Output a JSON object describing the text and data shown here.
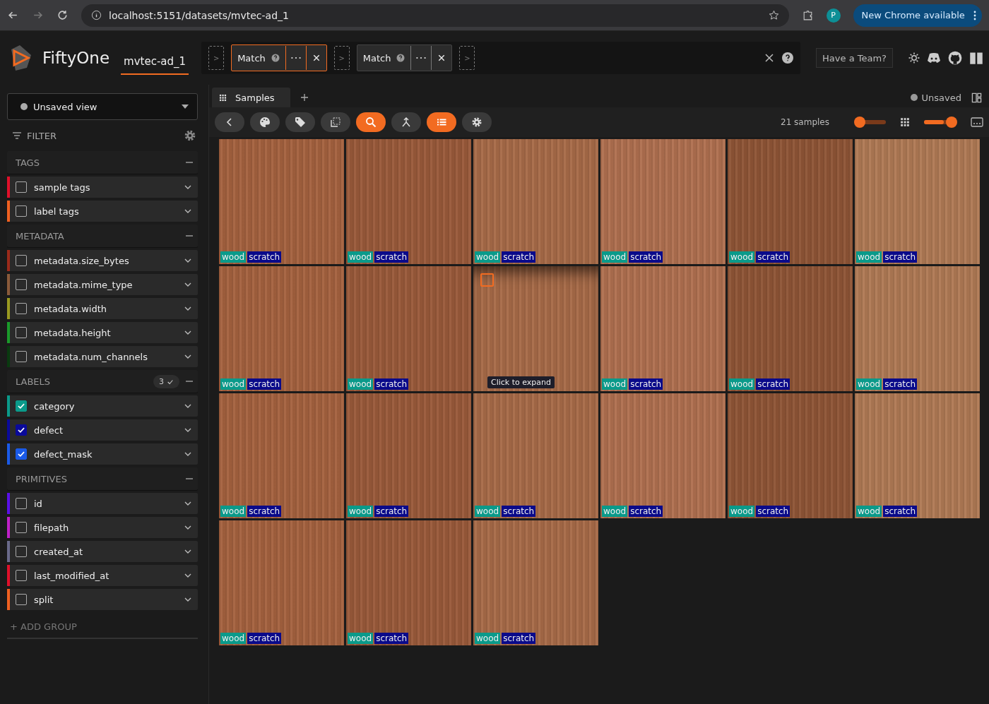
{
  "browser": {
    "url": "localhost:5151/datasets/mvtec-ad_1",
    "profile": "P",
    "update_button": "New Chrome available"
  },
  "header": {
    "app_name": "FiftyOne",
    "dataset": "mvtec-ad_1",
    "stages": [
      {
        "kind": "add",
        "label": ">"
      },
      {
        "kind": "stage",
        "label": "Match",
        "selected": true
      },
      {
        "kind": "add",
        "label": ">"
      },
      {
        "kind": "stage",
        "label": "Match",
        "selected": false
      },
      {
        "kind": "add",
        "label": ">"
      }
    ],
    "team_button": "Have a Team?"
  },
  "sidebar": {
    "view_selector": "Unsaved view",
    "filter_label": "FILTER",
    "groups": [
      {
        "title": "TAGS",
        "items": [
          {
            "label": "sample tags",
            "color": "#e0102a",
            "checked": false
          },
          {
            "label": "label tags",
            "color": "#f06020",
            "checked": false
          }
        ]
      },
      {
        "title": "METADATA",
        "items": [
          {
            "label": "metadata.size_bytes",
            "color": "#9b2a1a",
            "checked": false
          },
          {
            "label": "metadata.mime_type",
            "color": "#8a5a3a",
            "checked": false
          },
          {
            "label": "metadata.width",
            "color": "#9a9a20",
            "checked": false
          },
          {
            "label": "metadata.height",
            "color": "#1a9a2a",
            "checked": false
          },
          {
            "label": "metadata.num_channels",
            "color": "#0a3a10",
            "checked": false
          }
        ]
      },
      {
        "title": "LABELS",
        "badge": "3",
        "items": [
          {
            "label": "category",
            "color": "#0a9a8a",
            "checked": true
          },
          {
            "label": "defect",
            "color": "#0a0a9a",
            "checked": true
          },
          {
            "label": "defect_mask",
            "color": "#1a5ae8",
            "checked": true
          }
        ]
      },
      {
        "title": "PRIMITIVES",
        "items": [
          {
            "label": "id",
            "color": "#5a10e8",
            "checked": false
          },
          {
            "label": "filepath",
            "color": "#c020c8",
            "checked": false
          },
          {
            "label": "created_at",
            "color": "#6a6a8a",
            "checked": false
          },
          {
            "label": "last_modified_at",
            "color": "#e0102a",
            "checked": false
          },
          {
            "label": "split",
            "color": "#f06020",
            "checked": false
          }
        ]
      }
    ],
    "add_group": "+ ADD GROUP"
  },
  "tabs": [
    {
      "label": "Samples",
      "selected": true
    }
  ],
  "view_status": "Unsaved",
  "toolbar": {
    "buttons": [
      {
        "kind": "back",
        "active": false
      },
      {
        "kind": "palette",
        "active": false
      },
      {
        "kind": "tag",
        "active": false
      },
      {
        "kind": "select",
        "active": false
      },
      {
        "kind": "search",
        "active": true
      },
      {
        "kind": "merge",
        "active": false
      },
      {
        "kind": "list",
        "active": true
      },
      {
        "kind": "settings",
        "active": false
      }
    ],
    "count": "21 samples",
    "zoom_slider": {
      "level": 0.05
    },
    "size_slider": {
      "level": 0.7
    }
  },
  "samples": [
    {
      "tags": [
        {
          "label": "wood",
          "color": "#0a9a8a"
        },
        {
          "label": "scratch",
          "color": "#0a0a8a"
        }
      ]
    },
    {
      "tags": [
        {
          "label": "wood",
          "color": "#0a9a8a"
        },
        {
          "label": "scratch",
          "color": "#0a0a8a"
        }
      ]
    },
    {
      "tags": [
        {
          "label": "wood",
          "color": "#0a9a8a"
        },
        {
          "label": "scratch",
          "color": "#0a0a8a"
        }
      ]
    },
    {
      "tags": [
        {
          "label": "wood",
          "color": "#0a9a8a"
        },
        {
          "label": "scratch",
          "color": "#0a0a8a"
        }
      ]
    },
    {
      "tags": [
        {
          "label": "wood",
          "color": "#0a9a8a"
        },
        {
          "label": "scratch",
          "color": "#0a0a8a"
        }
      ]
    },
    {
      "tags": [
        {
          "label": "wood",
          "color": "#0a9a8a"
        },
        {
          "label": "scratch",
          "color": "#0a0a8a"
        }
      ]
    },
    {
      "tags": [
        {
          "label": "wood",
          "color": "#0a9a8a"
        },
        {
          "label": "scratch",
          "color": "#0a0a8a"
        }
      ]
    },
    {
      "tags": [
        {
          "label": "wood",
          "color": "#0a9a8a"
        },
        {
          "label": "scratch",
          "color": "#0a0a8a"
        }
      ]
    },
    {
      "hovered": true,
      "tooltip": "Click to expand"
    },
    {
      "tags": [
        {
          "label": "wood",
          "color": "#0a9a8a"
        },
        {
          "label": "scratch",
          "color": "#0a0a8a"
        }
      ]
    },
    {
      "tags": [
        {
          "label": "wood",
          "color": "#0a9a8a"
        },
        {
          "label": "scratch",
          "color": "#0a0a8a"
        }
      ]
    },
    {
      "tags": [
        {
          "label": "wood",
          "color": "#0a9a8a"
        },
        {
          "label": "scratch",
          "color": "#0a0a8a"
        }
      ]
    },
    {
      "tags": [
        {
          "label": "wood",
          "color": "#0a9a8a"
        },
        {
          "label": "scratch",
          "color": "#0a0a8a"
        }
      ]
    },
    {
      "tags": [
        {
          "label": "wood",
          "color": "#0a9a8a"
        },
        {
          "label": "scratch",
          "color": "#0a0a8a"
        }
      ]
    },
    {
      "tags": [
        {
          "label": "wood",
          "color": "#0a9a8a"
        },
        {
          "label": "scratch",
          "color": "#0a0a8a"
        }
      ]
    },
    {
      "tags": [
        {
          "label": "wood",
          "color": "#0a9a8a"
        },
        {
          "label": "scratch",
          "color": "#0a0a8a"
        }
      ]
    },
    {
      "tags": [
        {
          "label": "wood",
          "color": "#0a9a8a"
        },
        {
          "label": "scratch",
          "color": "#0a0a8a"
        }
      ]
    },
    {
      "tags": [
        {
          "label": "wood",
          "color": "#0a9a8a"
        },
        {
          "label": "scratch",
          "color": "#0a0a8a"
        }
      ]
    },
    {
      "tags": [
        {
          "label": "wood",
          "color": "#0a9a8a"
        },
        {
          "label": "scratch",
          "color": "#0a0a8a"
        }
      ]
    },
    {
      "tags": [
        {
          "label": "wood",
          "color": "#0a9a8a"
        },
        {
          "label": "scratch",
          "color": "#0a0a8a"
        }
      ]
    },
    {
      "tags": [
        {
          "label": "wood",
          "color": "#0a9a8a"
        },
        {
          "label": "scratch",
          "color": "#0a0a8a"
        }
      ]
    }
  ]
}
